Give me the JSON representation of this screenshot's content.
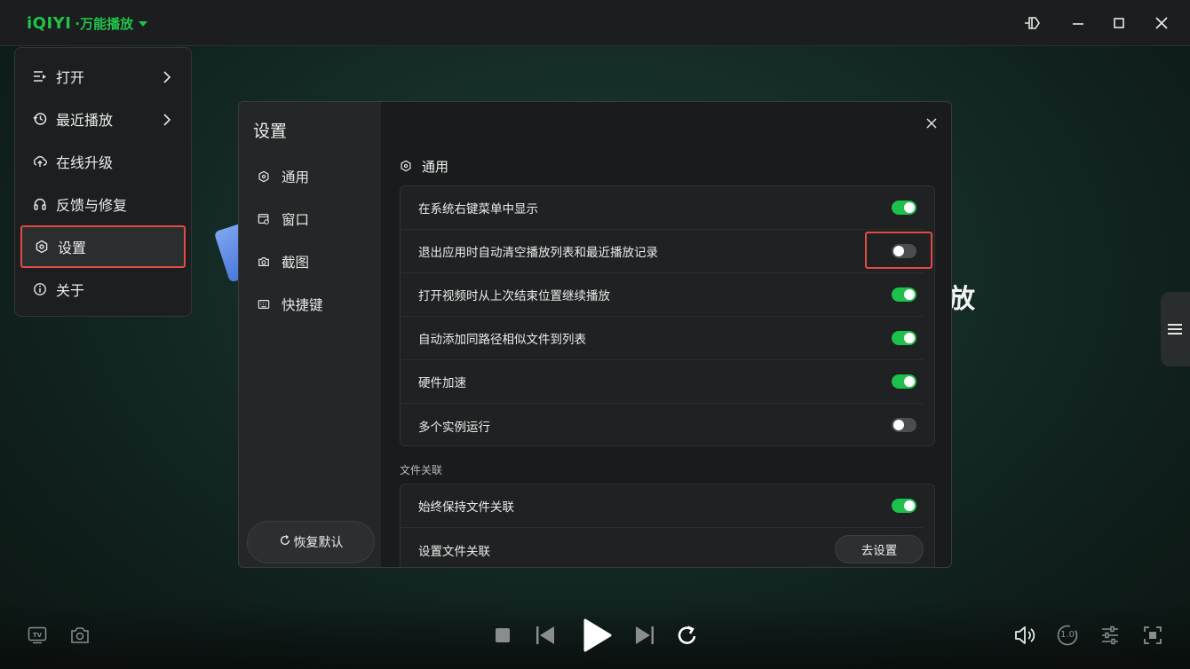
{
  "app": {
    "brand": "iQIYI",
    "product": "·万能播放"
  },
  "background": {
    "tail_char": "放"
  },
  "main_menu": {
    "items": [
      {
        "label": "打开",
        "icon": "open-list-icon",
        "has_submenu": true
      },
      {
        "label": "最近播放",
        "icon": "history-icon",
        "has_submenu": true
      },
      {
        "label": "在线升级",
        "icon": "upgrade-icon",
        "has_submenu": false
      },
      {
        "label": "反馈与修复",
        "icon": "headset-icon",
        "has_submenu": false
      },
      {
        "label": "设置",
        "icon": "settings-icon",
        "has_submenu": false,
        "active": true
      },
      {
        "label": "关于",
        "icon": "info-icon",
        "has_submenu": false
      }
    ]
  },
  "settings": {
    "title": "设置",
    "nav": [
      {
        "label": "通用",
        "icon": "general-icon"
      },
      {
        "label": "窗口",
        "icon": "window-icon"
      },
      {
        "label": "截图",
        "icon": "camera-icon"
      },
      {
        "label": "快捷键",
        "icon": "keyboard-icon"
      }
    ],
    "restore_label": "恢复默认",
    "section_title": "通用",
    "general_rows": [
      {
        "label": "在系统右键菜单中显示",
        "on": true
      },
      {
        "label": "退出应用时自动清空播放列表和最近播放记录",
        "on": false
      },
      {
        "label": "打开视频时从上次结束位置继续播放",
        "on": true
      },
      {
        "label": "自动添加同路径相似文件到列表",
        "on": true
      },
      {
        "label": "硬件加速",
        "on": true
      },
      {
        "label": "多个实例运行",
        "on": false
      }
    ],
    "file_assoc_label": "文件关联",
    "file_assoc_rows": [
      {
        "label": "始终保持文件关联",
        "on": true
      },
      {
        "label": "设置文件关联",
        "button": "去设置"
      }
    ]
  },
  "controls": {
    "speed_label": "1.0"
  },
  "colors": {
    "accent_green": "#1fbf4c",
    "highlight_red": "#e24a45"
  }
}
